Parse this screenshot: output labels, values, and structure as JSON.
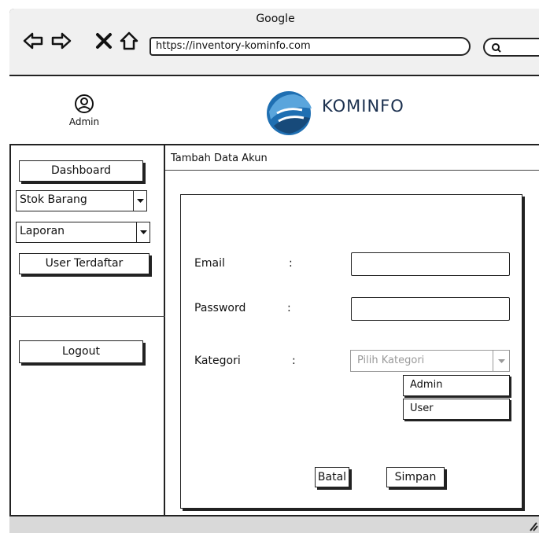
{
  "browser": {
    "title": "Google",
    "url": "https://inventory-kominfo.com"
  },
  "header": {
    "user_label": "Admin",
    "logo_text": "KOMINFO"
  },
  "sidebar": {
    "dashboard_label": "Dashboard",
    "stok_label": "Stok Barang",
    "laporan_label": "Laporan",
    "user_terdaftar_label": "User Terdaftar",
    "logout_label": "Logout"
  },
  "main": {
    "page_title": "Tambah Data Akun",
    "form": {
      "email_label": "Email",
      "password_label": "Password",
      "kategori_label": "Kategori",
      "colon": ":",
      "kategori_placeholder": "Pilih Kategori",
      "options": [
        "Admin",
        "User"
      ],
      "batal_label": "Batal",
      "simpan_label": "Simpan"
    }
  }
}
